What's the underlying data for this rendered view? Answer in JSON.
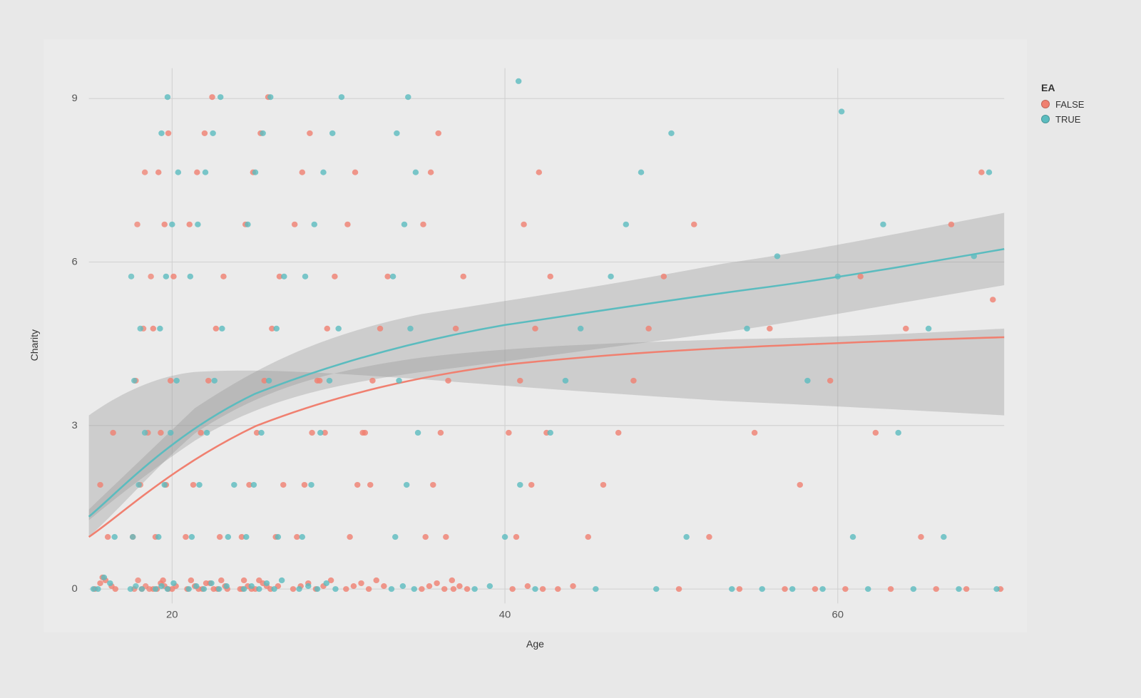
{
  "chart": {
    "title": "",
    "x_axis_label": "Age",
    "y_axis_label": "Charity",
    "x_ticks": [
      "20",
      "40",
      "60"
    ],
    "y_ticks": [
      "0",
      "3",
      "6",
      "9"
    ],
    "legend_title": "EA",
    "legend_items": [
      {
        "label": "FALSE",
        "color": "#f08070"
      },
      {
        "label": "TRUE",
        "color": "#5bbcbf"
      }
    ],
    "colors": {
      "false_color": "#f08070",
      "true_color": "#5bbcbf",
      "background": "#ebebeb",
      "grid": "#d8d8d8",
      "ci_fill": "rgba(160,160,160,0.4)"
    }
  }
}
